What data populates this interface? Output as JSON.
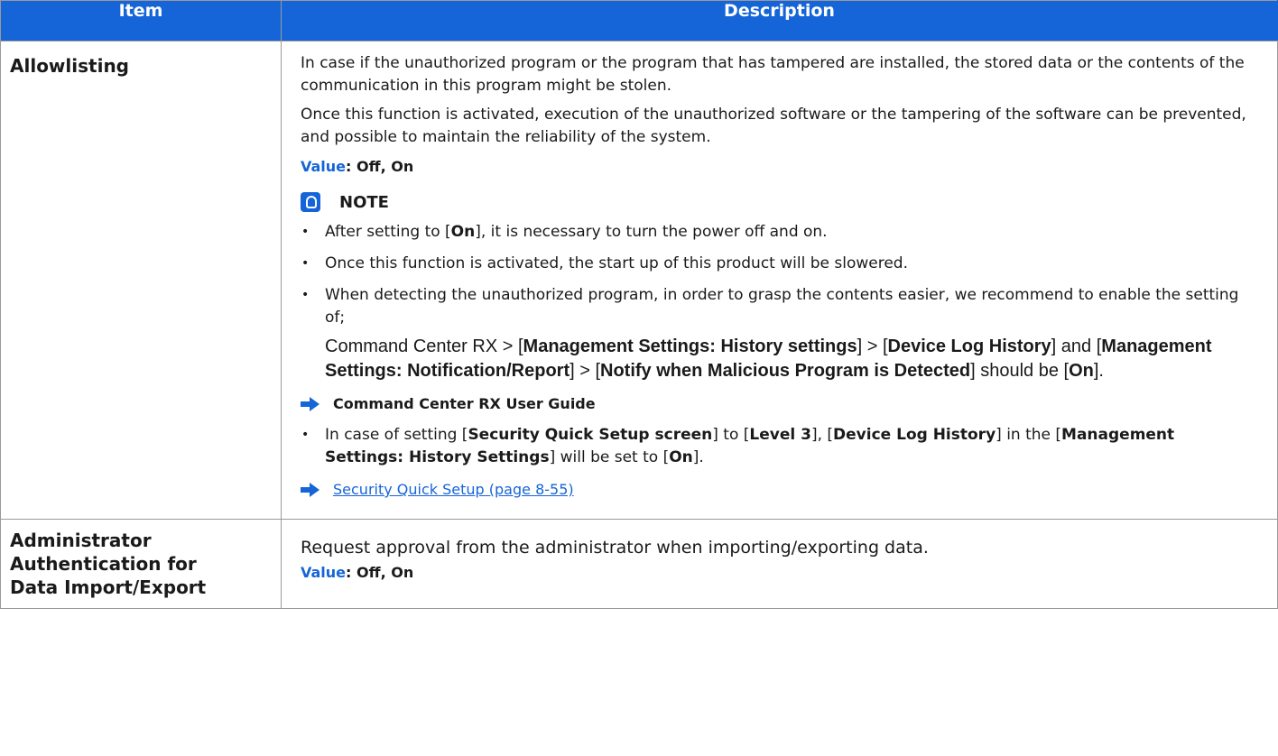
{
  "header": {
    "item_label": "Item",
    "description_label": "Description"
  },
  "rows": [
    {
      "item": "Allowlisting",
      "intro": "In case if the unauthorized program or the program that has tampered are installed, the stored data or the contents of the communication in this program might be stolen.",
      "detail": "Once this function is activated, execution of the unauthorized software or the tampering of the software can be prevented, and possible to maintain the reliability of the system.",
      "value_label": "Value",
      "value_text": ": Off, On",
      "note_label": "NOTE",
      "bullet1_pre": "After setting to [",
      "bullet1_bold": "On",
      "bullet1_post": "], it is necessary to turn the power off and on.",
      "bullet2": "Once this function is activated, the start up of this product will be slowered.",
      "bullet3": "When detecting the unauthorized program, in order to grasp the contents easier, we recommend to enable the setting of;",
      "cmd": {
        "p1": "Command Center RX > [",
        "b1": "Management Settings: History settings",
        "p2": "] > [",
        "b2": "Device Log History",
        "p3": "] and [",
        "b3": "Management Settings: Notification/Report",
        "p4": "] > [",
        "b4": "Notify when Malicious Program is Detected",
        "p5": "] should be [",
        "b5": "On",
        "p6": "]."
      },
      "guide_ref": "Command Center RX User Guide",
      "bullet4": {
        "p1": "In case of setting [",
        "b1": "Security Quick Setup screen",
        "p2": "] to [",
        "b2": "Level 3",
        "p3": "], [",
        "b3": "Device Log History",
        "p4": "] in the [",
        "b4": "Management Settings: History Settings",
        "p5": "] will be set to [",
        "b5": "On",
        "p6": "]."
      },
      "link_text": "Security Quick Setup (page 8-55)"
    },
    {
      "item_line1": "Administrator",
      "item_line2": "Authentication for",
      "item_line3": "Data Import/Export",
      "description": "Request approval from the administrator when importing/exporting data.",
      "value_label": "Value",
      "value_text": ": Off, On"
    }
  ],
  "colors": {
    "header_bg": "#1565d8",
    "accent": "#1565d8",
    "border": "#9a9a9a"
  },
  "icons": [
    "note-icon",
    "arrow-right-icon"
  ]
}
